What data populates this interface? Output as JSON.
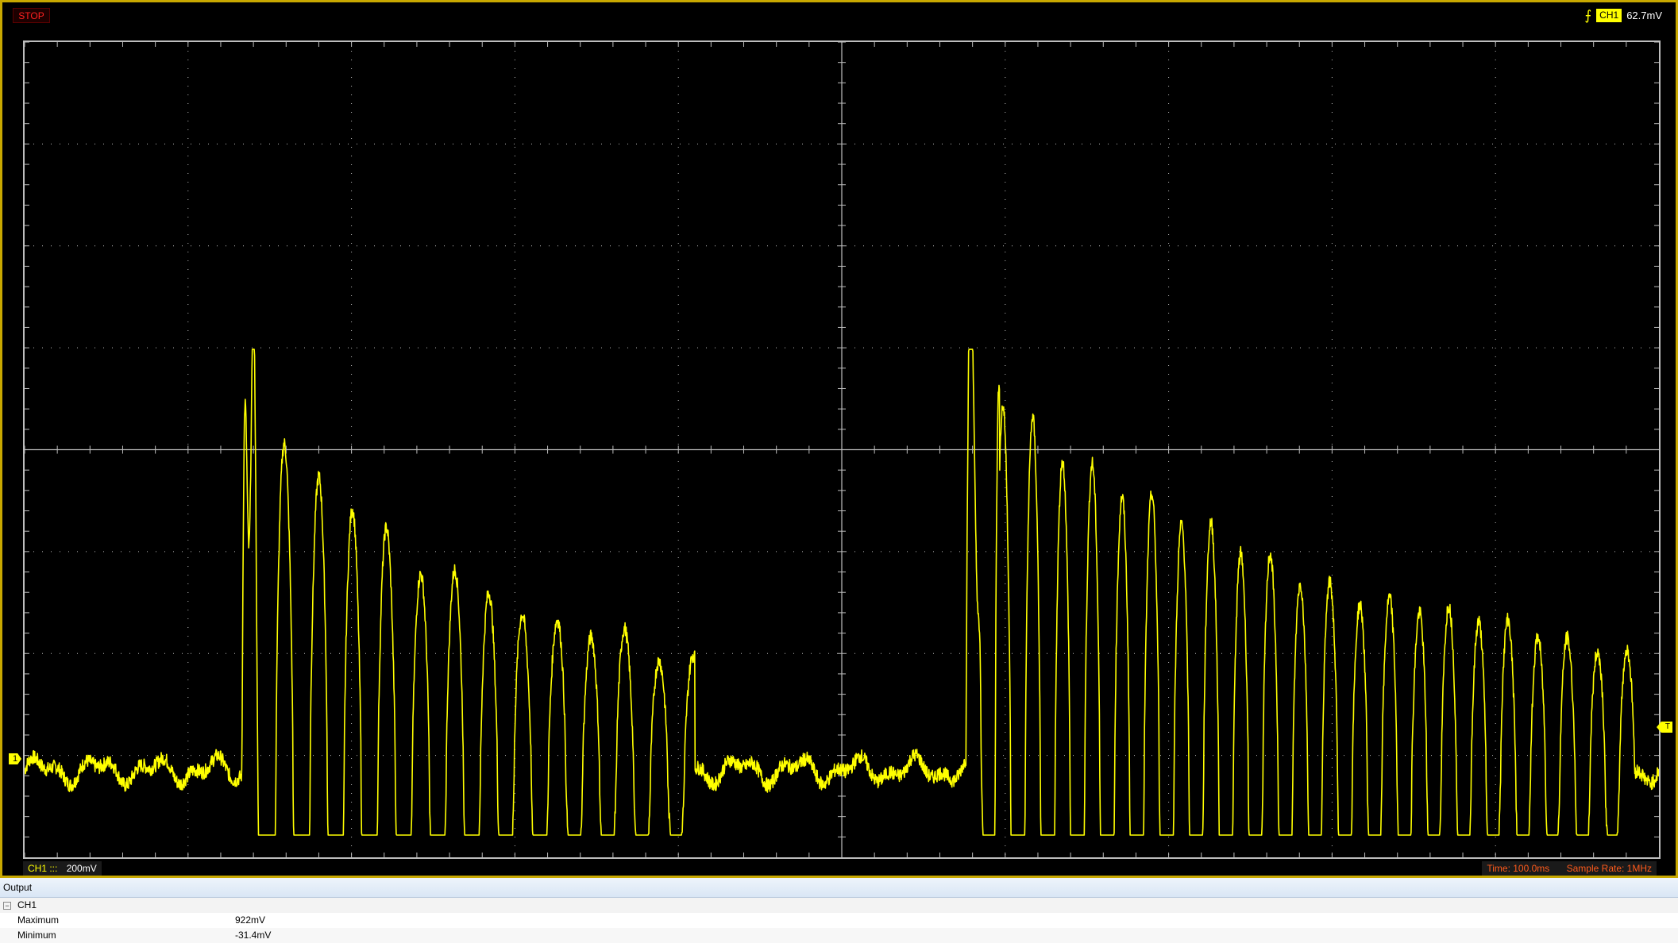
{
  "top_bar": {
    "run_state": "STOP",
    "trigger": {
      "edge_icon": "rising-edge-icon",
      "channel": "CH1",
      "level": "62.7mV"
    }
  },
  "display": {
    "trace_color": "#ffff00",
    "grid_color": "#bdbdbd",
    "divisions_x": 10,
    "divisions_y": 8,
    "ch1_marker": "1",
    "trigger_marker": "T"
  },
  "bottom_bar": {
    "ch1_label": "CH1 :::",
    "ch1_scale": "200mV",
    "time_label": "Time: 100.0ms",
    "sample_rate_label": "Sample Rate: 1MHz"
  },
  "output": {
    "title": "Output",
    "channel": "CH1",
    "rows": [
      {
        "label": "Maximum",
        "value": "922mV"
      },
      {
        "label": "Minimum",
        "value": "-31.4mV"
      }
    ]
  },
  "chart_data": {
    "type": "line",
    "series": [
      {
        "name": "CH1"
      }
    ],
    "y_unit": "V",
    "y_per_div": 0.2,
    "x_per_div": 0.1,
    "ylim": [
      -0.075,
      1.525
    ],
    "xlim": [
      0,
      1.0
    ],
    "baseline": 0.096,
    "max": 0.922,
    "min": -0.0314,
    "bursts": [
      {
        "start_t": 0.133,
        "peak": 0.87,
        "decay_end_t": 0.41
      },
      {
        "start_t": 0.576,
        "peak": 0.922,
        "decay_end_t": 0.985
      }
    ],
    "grid": true
  }
}
